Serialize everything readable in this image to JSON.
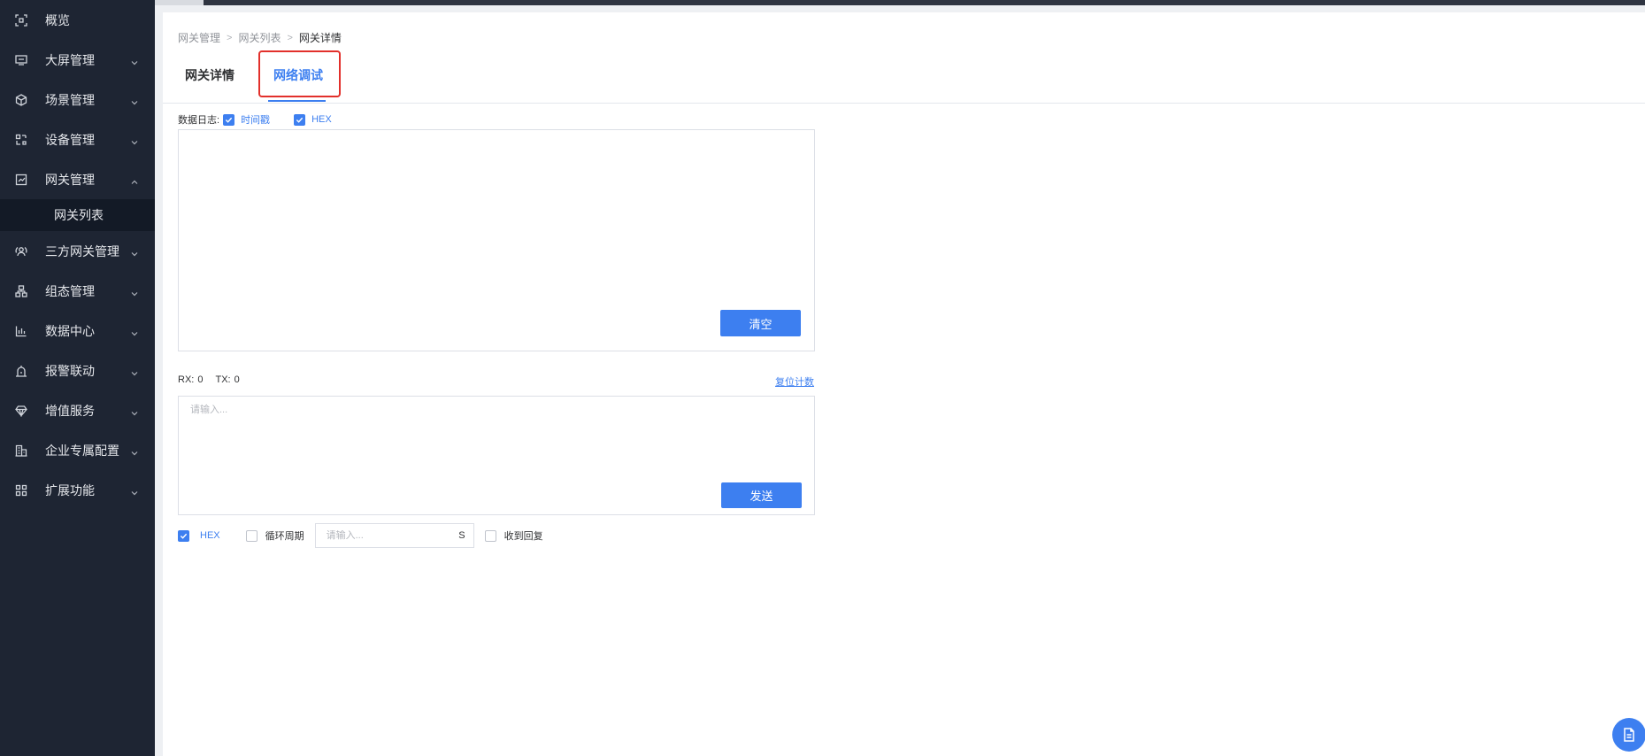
{
  "sidebar": {
    "items": [
      {
        "label": "概览",
        "icon": "scan-icon"
      },
      {
        "label": "大屏管理",
        "icon": "monitor-icon"
      },
      {
        "label": "场景管理",
        "icon": "cube-icon"
      },
      {
        "label": "设备管理",
        "icon": "device-grid-icon"
      },
      {
        "label": "网关管理",
        "icon": "chart-box-icon"
      },
      {
        "label": "三方网关管理",
        "icon": "user-group-icon"
      },
      {
        "label": "组态管理",
        "icon": "hierarchy-icon"
      },
      {
        "label": "数据中心",
        "icon": "bar-chart-icon"
      },
      {
        "label": "报警联动",
        "icon": "alarm-icon"
      },
      {
        "label": "增值服务",
        "icon": "diamond-icon"
      },
      {
        "label": "企业专属配置",
        "icon": "building-icon"
      },
      {
        "label": "扩展功能",
        "icon": "apps-icon"
      }
    ],
    "submenu_active": "网关列表"
  },
  "breadcrumb": [
    "网关管理",
    "网关列表",
    "网关详情"
  ],
  "tabs": [
    {
      "label": "网关详情"
    },
    {
      "label": "网络调试"
    }
  ],
  "log": {
    "label": "数据日志:",
    "timestamp_label": "时间戳",
    "hex_label": "HEX",
    "clear_label": "清空"
  },
  "stats": {
    "rx_label": "RX:",
    "rx_value": "0",
    "tx_label": "TX:",
    "tx_value": "0",
    "reset_label": "复位计数"
  },
  "send": {
    "placeholder": "请输入...",
    "send_label": "发送"
  },
  "bottom": {
    "hex_label": "HEX",
    "cycle_label": "循环周期",
    "cycle_placeholder": "请输入...",
    "cycle_unit": "S",
    "receive_reply_label": "收到回复"
  },
  "colors": {
    "accent": "#3d7ff0",
    "sidebar_bg": "#1e2533",
    "highlight": "#e2302b"
  }
}
